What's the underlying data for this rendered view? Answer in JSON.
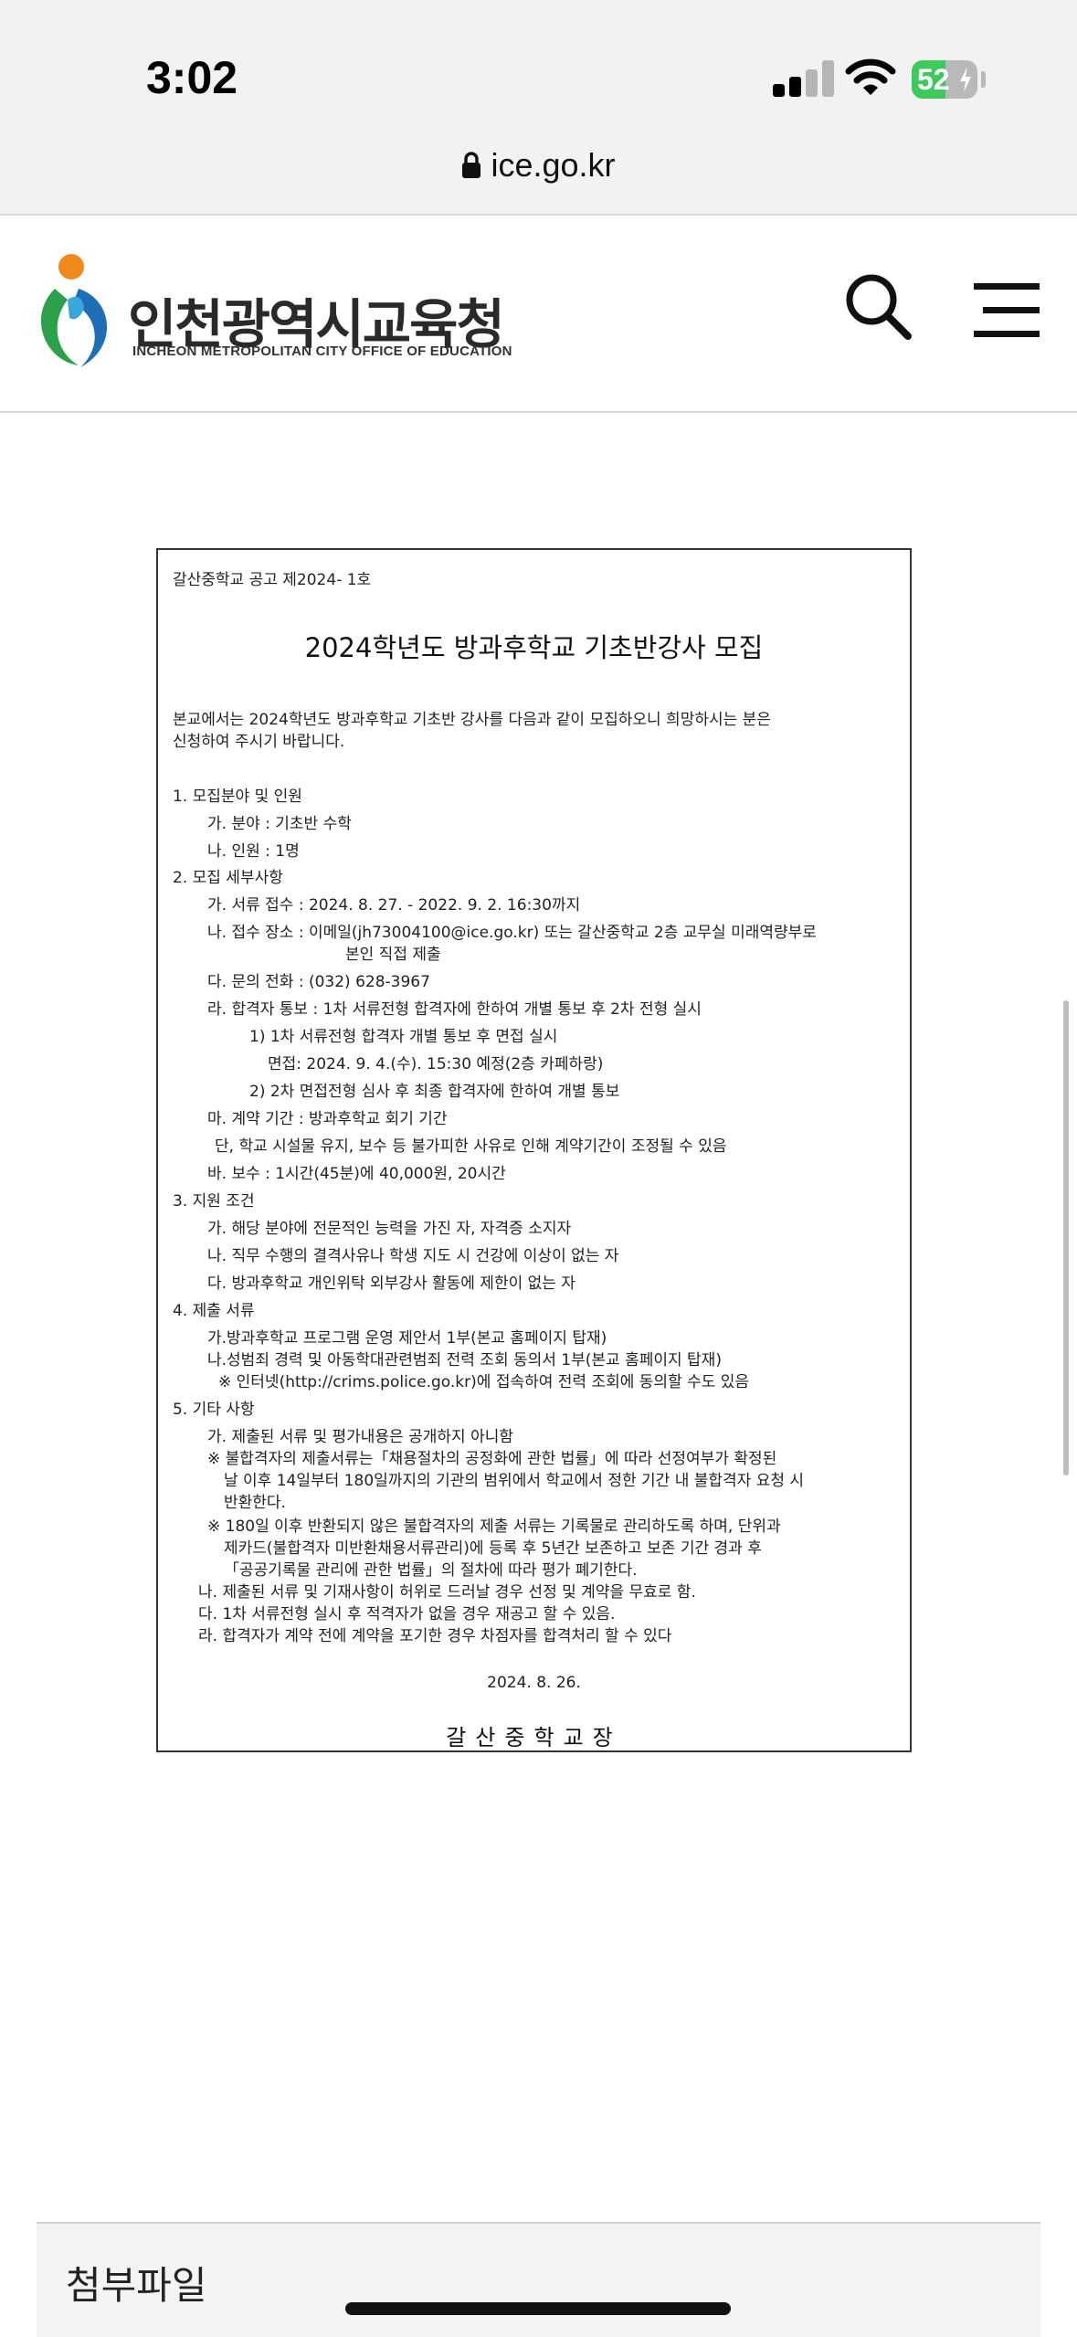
{
  "status_bar": {
    "time": "3:02",
    "battery": "52",
    "battery_level": 0.52
  },
  "browser": {
    "url": "ice.go.kr",
    "lock_icon": "lock-icon"
  },
  "site": {
    "logo_ko": "인천광역시교육청",
    "logo_en": "INCHEON METROPOLITAN CITY OFFICE OF EDUCATION",
    "colors": {
      "orange": "#f08a1c",
      "blue": "#1e6fb8",
      "green": "#2aa14a"
    }
  },
  "document": {
    "notice_no": "갈산중학교 공고 제2024- 1호",
    "title": "2024학년도 방과후학교 기초반강사 모집",
    "lines": [
      "  본교에서는 2024학년도 방과후학교 기초반 강사를 다음과 같이 모집하오니 희망하시는 분은",
      "신청하여 주시기 바랍니다.",
      "1. 모집분야 및 인원",
      "가. 분야 : 기초반 수학",
      "나. 인원 : 1명",
      "2. 모집 세부사항",
      "가. 서류 접수 : 2024. 8. 27. - 2022. 9. 2. 16:30까지",
      "나. 접수 장소 : 이메일(jh73004100@ice.go.kr) 또는 갈산중학교 2층 교무실 미래역량부로",
      "본인 직접 제출",
      "다. 문의 전화 : (032) 628-3967",
      "라. 합격자 통보 : 1차 서류전형 합격자에 한하여 개별 통보 후 2차 전형 실시",
      "1) 1차 서류전형 합격자 개별 통보 후 면접 실시",
      "면접: 2024. 9. 4.(수). 15:30 예정(2층 카페하랑)",
      "2) 2차 면접전형 심사 후 최종 합격자에 한하여 개별 통보",
      "마. 계약 기간 : 방과후학교 회기 기간",
      "단, 학교 시설물 유지, 보수 등 불가피한 사유로 인해 계약기간이 조정될 수 있음",
      "바. 보수 : 1시간(45분)에 40,000원, 20시간",
      "3. 지원 조건",
      "가. 해당 분야에 전문적인 능력을 가진 자, 자격증 소지자",
      "나. 직무 수행의 결격사유나 학생 지도 시 건강에 이상이 없는 자",
      "다. 방과후학교 개인위탁 외부강사 활동에 제한이 없는 자",
      "4. 제출 서류",
      "가.방과후학교 프로그램 운영 제안서 1부(본교 홈페이지 탑재)",
      "나.성범죄 경력 및 아동학대관련범죄 전력 조회 동의서 1부(본교 홈페이지 탑재)",
      "※ 인터넷(http://crims.police.go.kr)에 접속하여 전력 조회에 동의할 수도 있음",
      "5. 기타 사항",
      "가. 제출된 서류 및 평가내용은 공개하지 아니함",
      "※ 불합격자의 제출서류는「채용절차의 공정화에 관한 법률」에 따라 선정여부가 확정된",
      "날 이후 14일부터 180일까지의 기관의 범위에서 학교에서 정한 기간 내 불합격자 요청 시",
      "반환한다.",
      "※ 180일 이후 반환되지 않은 불합격자의 제출 서류는 기록물로 관리하도록 하며, 단위과",
      "제카드(불합격자 미반환채용서류관리)에 등록 후 5년간 보존하고 보존 기간 경과 후",
      "「공공기록물 관리에 관한 법률」의 절차에 따라 평가 폐기한다.",
      "나. 제출된 서류 및 기재사항이 허위로 드러날 경우 선정 및 계약을 무효로 함.",
      "다. 1차 서류전형 실시 후 적격자가 없을 경우 재공고 할 수 있음.",
      "라. 합격자가 계약 전에 계약을 포기한 경우 차점자를 합격처리 할 수 있다"
    ],
    "date": "2024. 8. 26.",
    "signature": "갈산중학교장"
  },
  "attachments": {
    "title": "첨부파일"
  }
}
